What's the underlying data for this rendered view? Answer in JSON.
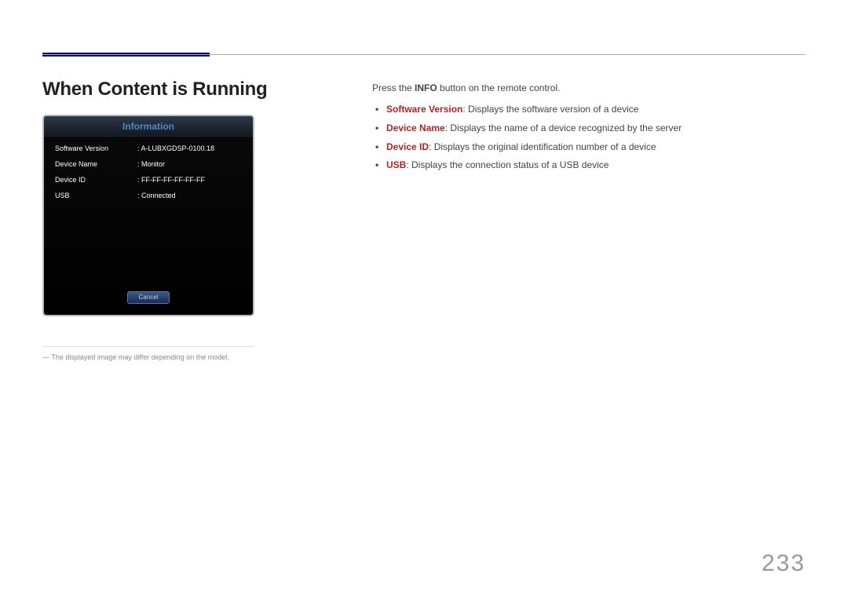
{
  "heading": "When Content is Running",
  "infoPanel": {
    "title": "Information",
    "rows": [
      {
        "label": "Software Version",
        "value": ": A-LUBXGDSP-0100.18"
      },
      {
        "label": "Device Name",
        "value": ": Monitor"
      },
      {
        "label": "Device ID",
        "value": ": FF-FF-FF-FF-FF-FF"
      },
      {
        "label": "USB",
        "value": ": Connected"
      }
    ],
    "cancel": "Cancel"
  },
  "footnote": "― The displayed image may differ depending on the model.",
  "right": {
    "introPrefix": "Press the ",
    "introBold": "INFO",
    "introSuffix": " button on the remote control.",
    "bullets": [
      {
        "term": "Software Version",
        "desc": ": Displays the software version of a device"
      },
      {
        "term": "Device Name",
        "desc": ": Displays the name of a device recognized by the server"
      },
      {
        "term": "Device ID",
        "desc": ": Displays the original identification number of a device"
      },
      {
        "term": "USB",
        "desc": ": Displays the connection status of a USB device"
      }
    ]
  },
  "pageNumber": "233"
}
